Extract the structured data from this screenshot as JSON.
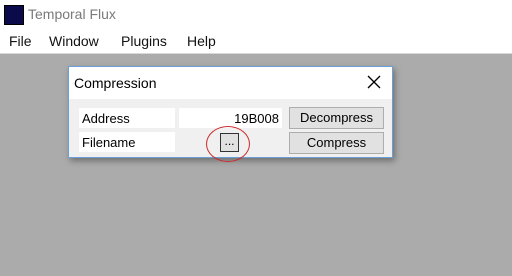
{
  "window": {
    "title": "Temporal Flux"
  },
  "menu": {
    "items": [
      "File",
      "Window",
      "Plugins",
      "Help"
    ]
  },
  "dialog": {
    "title": "Compression",
    "rows": [
      {
        "label": "Address",
        "value": "19B008",
        "button": "Decompress"
      },
      {
        "label": "Filename",
        "browse": "...",
        "button": "Compress"
      }
    ]
  },
  "colors": {
    "workspace": "#ababab",
    "app_icon": "#0b0a4a",
    "annotation": "#cc2a2a"
  },
  "icons": {
    "close": "close-icon",
    "app": "app-icon"
  }
}
